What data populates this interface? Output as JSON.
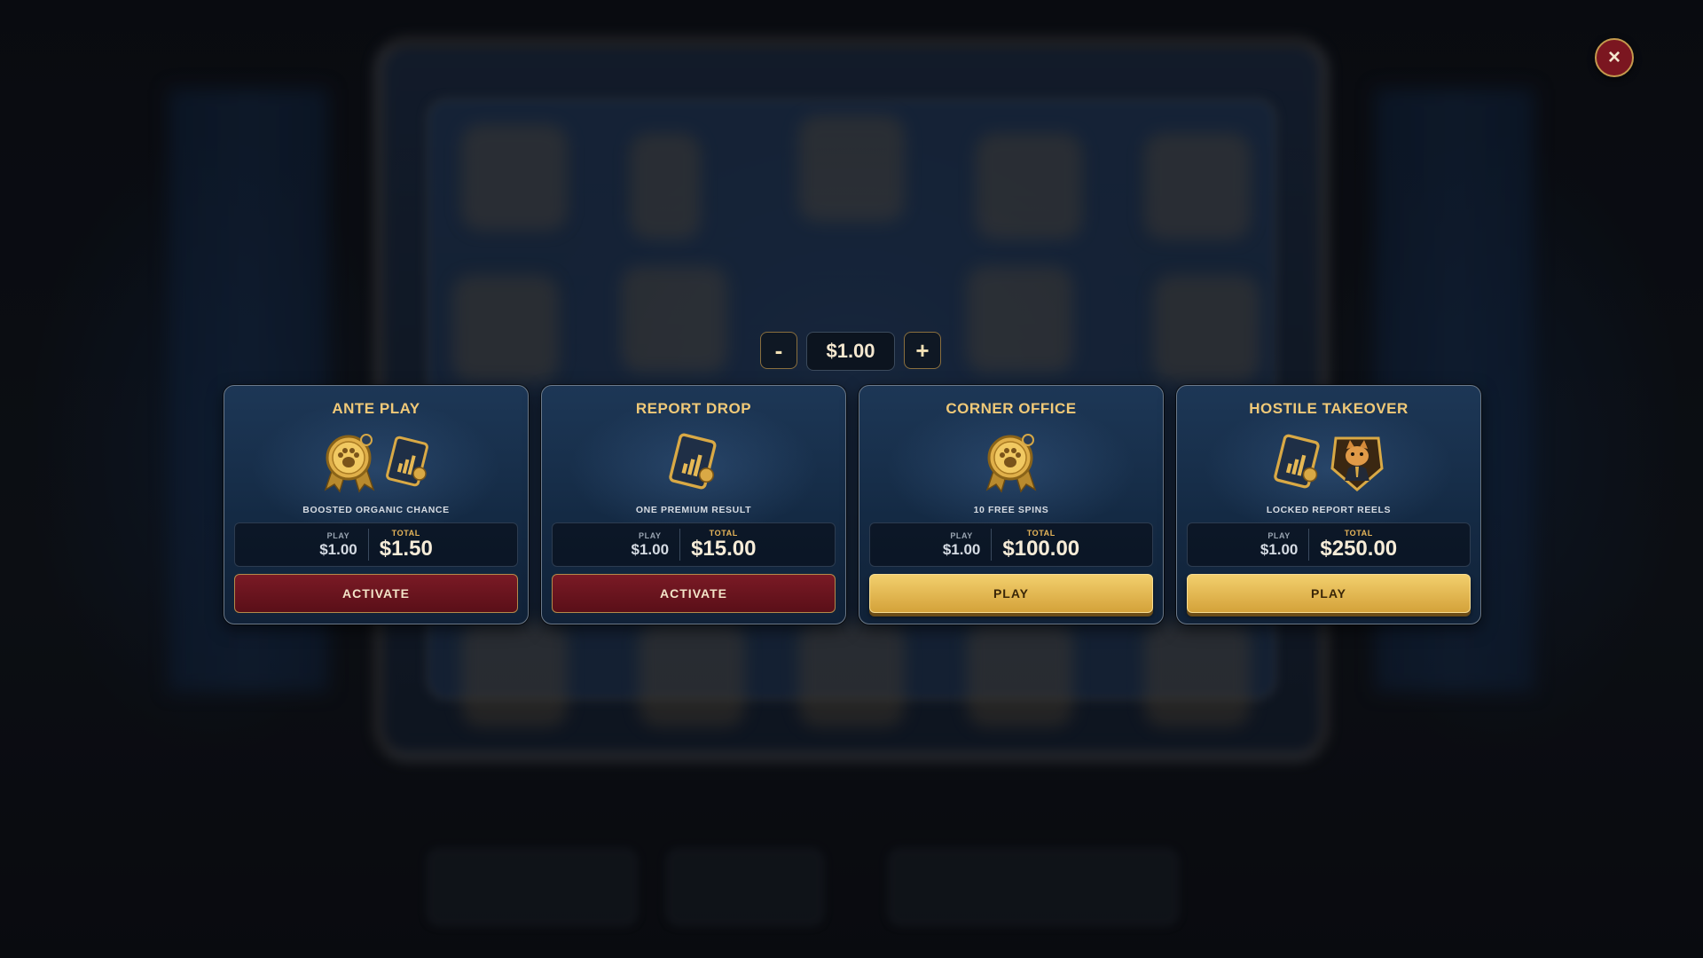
{
  "bet": {
    "minus_label": "-",
    "value": "$1.00",
    "plus_label": "+"
  },
  "close": {
    "label": "×"
  },
  "cards": [
    {
      "title": "ANTE PLAY",
      "icons": [
        "paw-medal-icon",
        "report-chart-icon"
      ],
      "description": "BOOSTED ORGANIC CHANCE",
      "play_label": "PLAY",
      "play_value": "$1.00",
      "total_label": "TOTAL",
      "total_value": "$1.50",
      "button": "ACTIVATE",
      "button_style": "activate"
    },
    {
      "title": "REPORT DROP",
      "icons": [
        "report-chart-icon"
      ],
      "description": "ONE PREMIUM RESULT",
      "play_label": "PLAY",
      "play_value": "$1.00",
      "total_label": "TOTAL",
      "total_value": "$15.00",
      "button": "ACTIVATE",
      "button_style": "activate"
    },
    {
      "title": "CORNER OFFICE",
      "icons": [
        "paw-medal-icon"
      ],
      "description": "10 FREE SPINS",
      "play_label": "PLAY",
      "play_value": "$1.00",
      "total_label": "TOTAL",
      "total_value": "$100.00",
      "button": "PLAY",
      "button_style": "play"
    },
    {
      "title": "HOSTILE TAKEOVER",
      "icons": [
        "report-chart-icon",
        "cat-boss-portrait-icon"
      ],
      "description": "LOCKED REPORT REELS",
      "play_label": "PLAY",
      "play_value": "$1.00",
      "total_label": "TOTAL",
      "total_value": "$250.00",
      "button": "PLAY",
      "button_style": "play"
    }
  ],
  "colors": {
    "gold": "#f0c978",
    "activate": "#7a1a25",
    "play": "#e6bb55",
    "card_bg": "#1d3756"
  }
}
